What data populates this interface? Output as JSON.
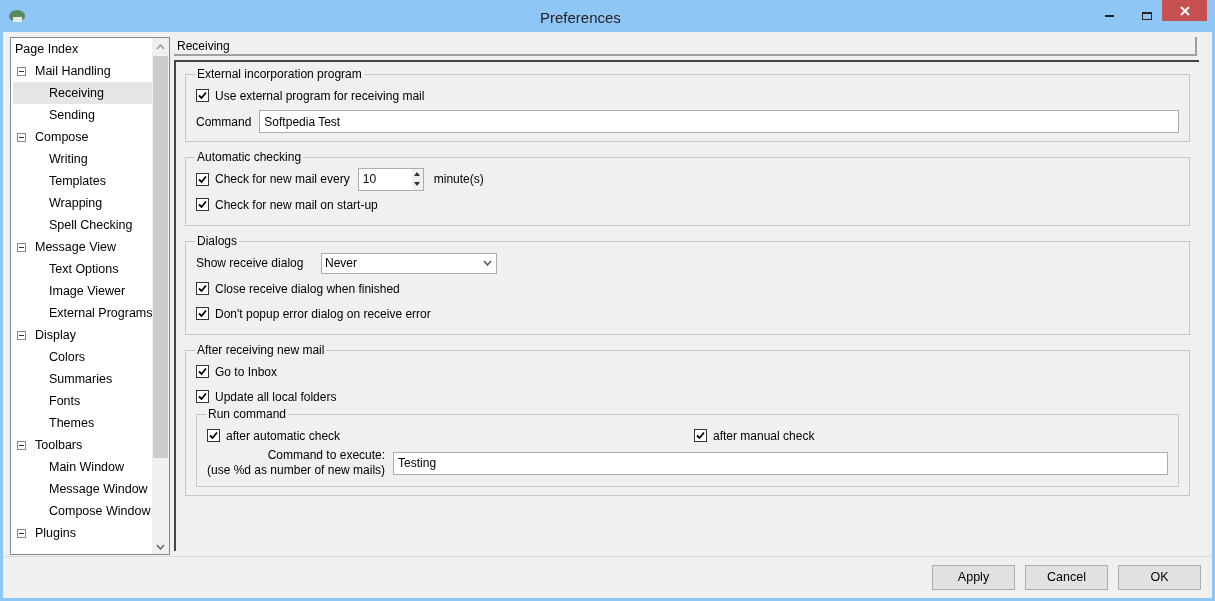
{
  "window": {
    "title": "Preferences"
  },
  "page_index": {
    "heading": "Page Index",
    "items": [
      {
        "label": "Mail Handling",
        "expanded": true,
        "selected": false,
        "children": [
          {
            "label": "Receiving",
            "selected": true
          },
          {
            "label": "Sending",
            "selected": false
          }
        ]
      },
      {
        "label": "Compose",
        "expanded": true,
        "selected": false,
        "children": [
          {
            "label": "Writing",
            "selected": false
          },
          {
            "label": "Templates",
            "selected": false
          },
          {
            "label": "Wrapping",
            "selected": false
          },
          {
            "label": "Spell Checking",
            "selected": false
          }
        ]
      },
      {
        "label": "Message View",
        "expanded": true,
        "selected": false,
        "children": [
          {
            "label": "Text Options",
            "selected": false
          },
          {
            "label": "Image Viewer",
            "selected": false
          },
          {
            "label": "External Programs",
            "selected": false
          }
        ]
      },
      {
        "label": "Display",
        "expanded": true,
        "selected": false,
        "children": [
          {
            "label": "Colors",
            "selected": false
          },
          {
            "label": "Summaries",
            "selected": false
          },
          {
            "label": "Fonts",
            "selected": false
          },
          {
            "label": "Themes",
            "selected": false
          }
        ]
      },
      {
        "label": "Toolbars",
        "expanded": true,
        "selected": false,
        "children": [
          {
            "label": "Main Window",
            "selected": false
          },
          {
            "label": "Message Window",
            "selected": false
          },
          {
            "label": "Compose Window",
            "selected": false
          }
        ]
      },
      {
        "label": "Plugins",
        "expanded": true,
        "selected": false
      }
    ]
  },
  "page_title": "Receiving",
  "external": {
    "title": "External incorporation program",
    "use_external": {
      "label": "Use external program for receiving mail",
      "checked": true
    },
    "command_label": "Command",
    "command_value": "Softpedia Test"
  },
  "automatic": {
    "title": "Automatic checking",
    "check_every": {
      "label": "Check for new mail every",
      "checked": true
    },
    "interval": "10",
    "unit": "minute(s)",
    "startup": {
      "label": "Check for new mail on start-up",
      "checked": true
    }
  },
  "dialogs": {
    "title": "Dialogs",
    "show_label": "Show receive dialog",
    "show_value": "Never",
    "options": [
      {
        "label": "Close receive dialog when finished",
        "checked": true
      },
      {
        "label": "Don't popup error dialog on receive error",
        "checked": true
      }
    ]
  },
  "after": {
    "title": "After receiving new mail",
    "options": [
      {
        "label": "Go to Inbox",
        "checked": true
      },
      {
        "label": "Update all local folders",
        "checked": true
      }
    ],
    "run": {
      "title": "Run command",
      "auto": {
        "label": "after automatic check",
        "checked": true
      },
      "manual": {
        "label": "after manual check",
        "checked": true
      },
      "command_label": "Command to execute:",
      "command_hint": "(use %d as number of new mails)",
      "command_value": "Testing"
    }
  },
  "buttons": [
    "Apply",
    "Cancel",
    "OK"
  ]
}
